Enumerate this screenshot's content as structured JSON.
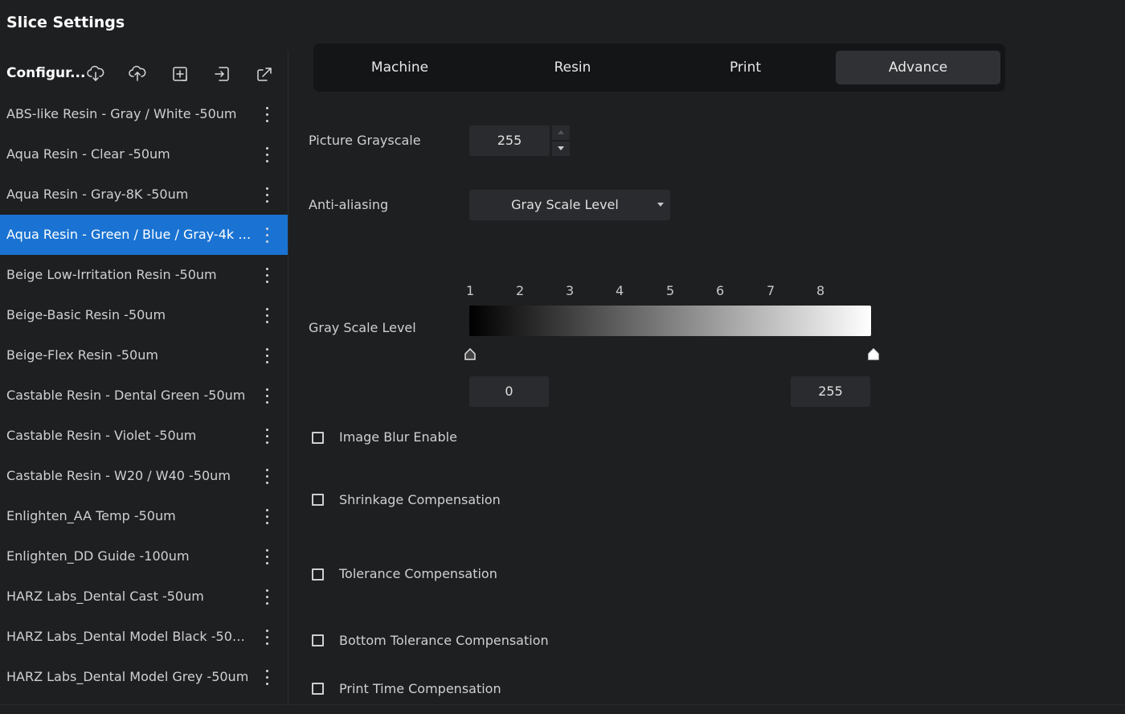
{
  "window": {
    "title": "Slice Settings"
  },
  "sidebar": {
    "header_label": "Configur...",
    "header_icons": [
      "cloud-download-icon",
      "cloud-upload-icon",
      "add-config-icon",
      "import-icon",
      "export-icon"
    ],
    "selected_index": 3,
    "items": [
      {
        "label": "ABS-like Resin - Gray / White -50um"
      },
      {
        "label": "Aqua Resin - Clear -50um"
      },
      {
        "label": "Aqua Resin - Gray-8K -50um"
      },
      {
        "label": "Aqua Resin - Green / Blue / Gray-4k / ..."
      },
      {
        "label": "Beige Low-Irritation Resin -50um"
      },
      {
        "label": "Beige-Basic Resin -50um"
      },
      {
        "label": "Beige-Flex Resin -50um"
      },
      {
        "label": "Castable Resin - Dental Green -50um"
      },
      {
        "label": "Castable Resin - Violet -50um"
      },
      {
        "label": "Castable Resin - W20 / W40 -50um"
      },
      {
        "label": "Enlighten_AA Temp -50um"
      },
      {
        "label": "Enlighten_DD Guide -100um"
      },
      {
        "label": "HARZ Labs_Dental Cast -50um"
      },
      {
        "label": "HARZ Labs_Dental Model Black -50um"
      },
      {
        "label": "HARZ Labs_Dental Model Grey -50um"
      }
    ]
  },
  "tabs": [
    {
      "label": "Machine"
    },
    {
      "label": "Resin"
    },
    {
      "label": "Print"
    },
    {
      "label": "Advance"
    }
  ],
  "active_tab": "Advance",
  "settings": {
    "picture_grayscale": {
      "label": "Picture Grayscale",
      "value": "255"
    },
    "anti_aliasing": {
      "label": "Anti-aliasing",
      "value": "Gray Scale Level"
    },
    "gray_scale_level": {
      "label": "Gray Scale Level",
      "ticks": [
        "1",
        "2",
        "3",
        "4",
        "5",
        "6",
        "7",
        "8"
      ],
      "min_value": "0",
      "max_value": "255"
    },
    "checkboxes": [
      {
        "label": "Image Blur Enable",
        "checked": false
      },
      {
        "label": "Shrinkage Compensation",
        "checked": false
      },
      {
        "label": "Tolerance Compensation",
        "checked": false
      },
      {
        "label": "Bottom Tolerance Compensation",
        "checked": false
      },
      {
        "label": "Print Time Compensation",
        "checked": false
      }
    ]
  },
  "colors": {
    "background": "#1e1f21",
    "selection": "#1a73d2",
    "tab_bar": "#141517",
    "active_tab": "#2f3135",
    "field": "#2a2b2e"
  }
}
